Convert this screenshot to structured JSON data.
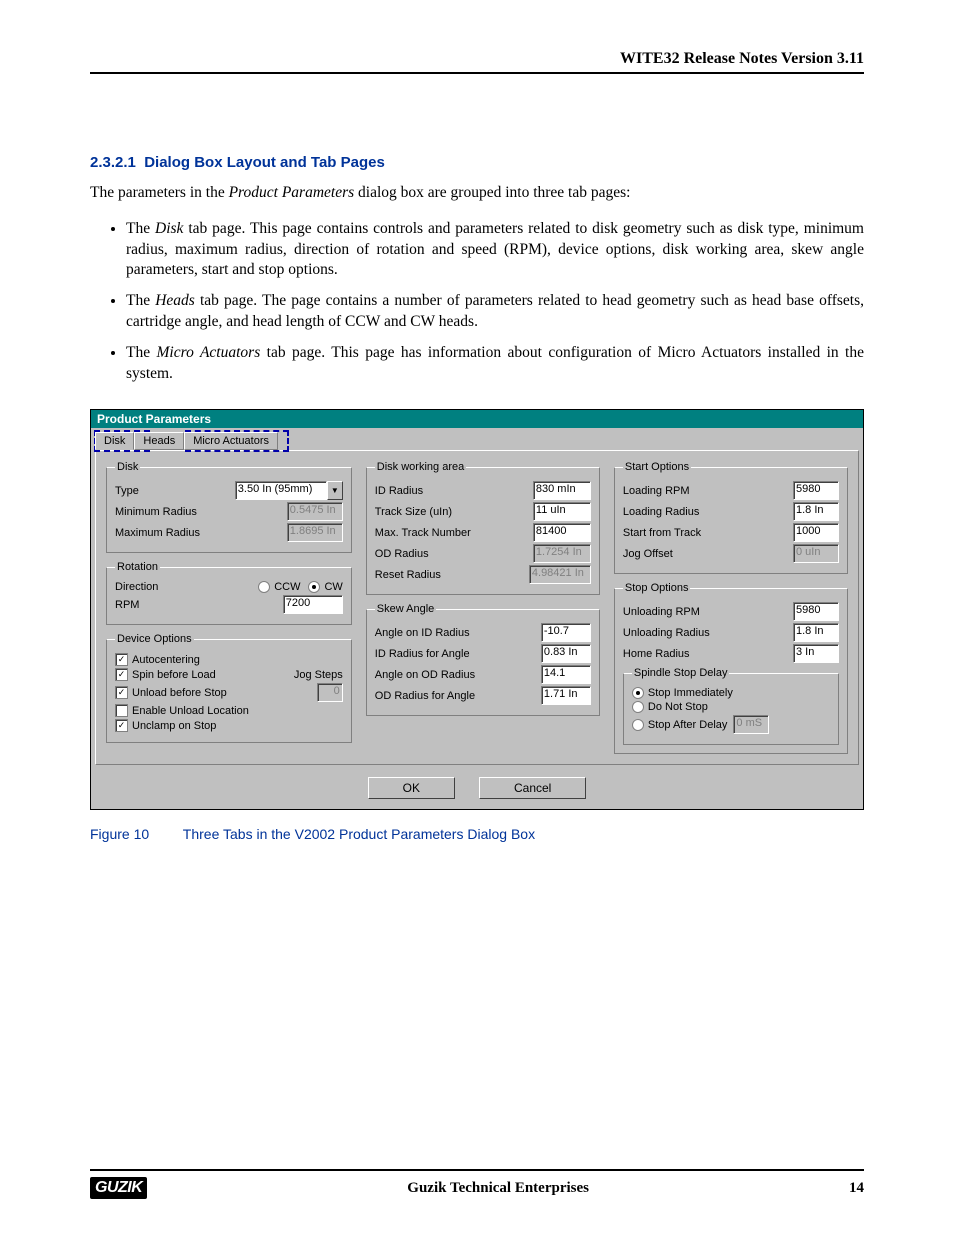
{
  "header": {
    "title": "WITE32 Release Notes Version 3.11"
  },
  "section": {
    "number": "2.3.2.1",
    "title": "Dialog Box Layout and Tab Pages",
    "intro_pre": "The parameters in the ",
    "intro_em": "Product Parameters",
    "intro_post": " dialog box are grouped into three tab pages:",
    "bullets": {
      "b1_pre": "The ",
      "b1_em": "Disk",
      "b1_post": " tab page. This page contains controls and parameters related to disk geometry such as disk type, minimum radius, maximum radius, direction of rotation and speed (RPM), device options, disk working area, skew angle parameters, start and stop options.",
      "b2_pre": "The ",
      "b2_em": "Heads",
      "b2_post": " tab page. The page contains a number of parameters related to head geometry such as head base offsets, cartridge angle, and head length of CCW and CW heads.",
      "b3_pre": "The ",
      "b3_em": "Micro Actuators",
      "b3_post": " tab page. This page has information about configuration of Micro Actuators installed in the system."
    }
  },
  "dialog": {
    "title": "Product Parameters",
    "tabs": {
      "t1": "Disk",
      "t2": "Heads",
      "t3": "Micro Actuators"
    },
    "disk": {
      "legend": "Disk",
      "type_label": "Type",
      "type_value": "3.50 In (95mm)",
      "min_label": "Minimum Radius",
      "min_value": "0.5475 In",
      "max_label": "Maximum Radius",
      "max_value": "1.8695 In"
    },
    "rotation": {
      "legend": "Rotation",
      "dir_label": "Direction",
      "ccw": "CCW",
      "cw": "CW",
      "rpm_label": "RPM",
      "rpm_value": "7200"
    },
    "device": {
      "legend": "Device Options",
      "opt1": "Autocentering",
      "opt2": "Spin before Load",
      "opt3": "Unload before Stop",
      "opt4": "Enable Unload Location",
      "opt5": "Unclamp on Stop",
      "jog_label": "Jog Steps",
      "jog_value": "0"
    },
    "work": {
      "legend": "Disk working area",
      "id_label": "ID Radius",
      "id_value": "830 mIn",
      "ts_label": "Track Size (uIn)",
      "ts_value": "11 uIn",
      "mt_label": "Max. Track Number",
      "mt_value": "81400",
      "od_label": "OD Radius",
      "od_value": "1.7254 In",
      "rr_label": "Reset Radius",
      "rr_value": "4.98421 In"
    },
    "skew": {
      "legend": "Skew Angle",
      "aid_label": "Angle on ID Radius",
      "aid_value": "-10.7",
      "idr_label": "ID Radius for Angle",
      "idr_value": "0.83 In",
      "aod_label": "Angle on OD Radius",
      "aod_value": "14.1",
      "odr_label": "OD Radius for Angle",
      "odr_value": "1.71 In"
    },
    "start": {
      "legend": "Start Options",
      "lr_label": "Loading RPM",
      "lr_value": "5980",
      "lrad_label": "Loading Radius",
      "lrad_value": "1.8 In",
      "st_label": "Start from Track",
      "st_value": "1000",
      "jo_label": "Jog Offset",
      "jo_value": "0 uIn"
    },
    "stop": {
      "legend": "Stop Options",
      "ur_label": "Unloading RPM",
      "ur_value": "5980",
      "urad_label": "Unloading Radius",
      "urad_value": "1.8 In",
      "hr_label": "Home Radius",
      "hr_value": "3 In",
      "ssd_legend": "Spindle Stop Delay",
      "r1": "Stop Immediately",
      "r2": "Do Not Stop",
      "r3": "Stop After Delay",
      "r3v": "0 mS"
    },
    "buttons": {
      "ok": "OK",
      "cancel": "Cancel"
    }
  },
  "caption": {
    "fig": "Figure 10",
    "text": "Three Tabs in the V2002 Product Parameters Dialog Box"
  },
  "footer": {
    "logo": "GUZIK",
    "center": "Guzik Technical Enterprises",
    "page": "14"
  }
}
